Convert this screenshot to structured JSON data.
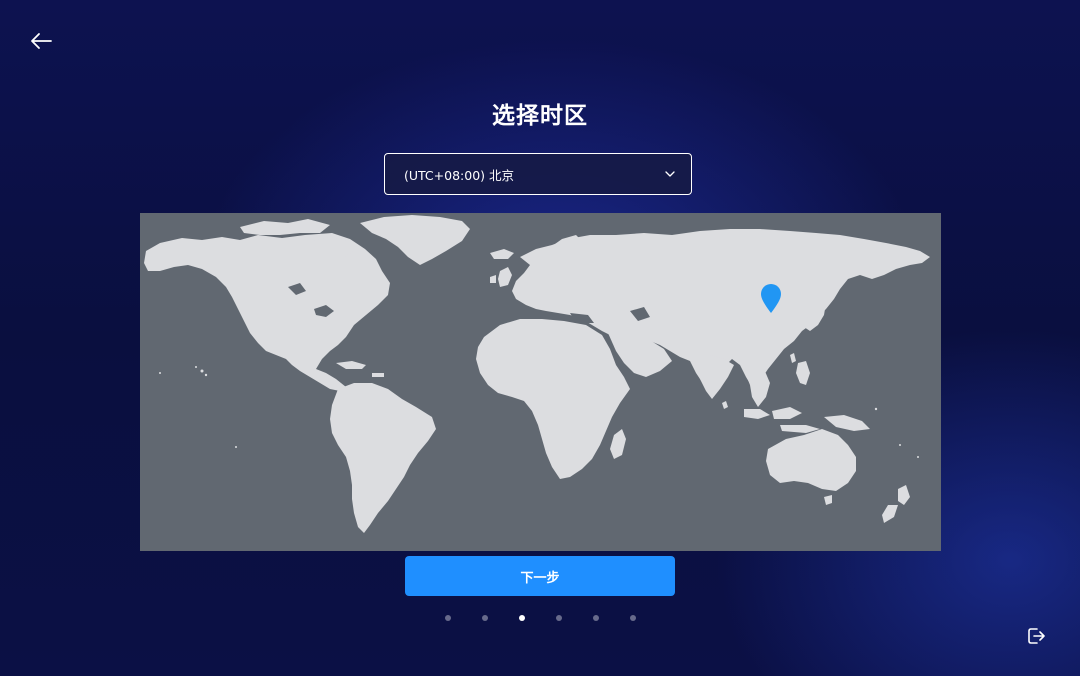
{
  "header": {
    "back_icon": "arrow-left-icon",
    "title": "选择时区"
  },
  "timezone_select": {
    "value": "(UTC+08:00) 北京",
    "chevron_icon": "chevron-down-icon"
  },
  "map": {
    "marker_icon": "map-pin-icon",
    "marker_location": "北京",
    "colors": {
      "ocean": "#616871",
      "land": "#dcdde0",
      "marker": "#2196f3"
    }
  },
  "next_button": {
    "label": "下一步"
  },
  "pager": {
    "total": 6,
    "active_index": 2
  },
  "footer": {
    "exit_icon": "logout-icon"
  },
  "colors": {
    "background": "#0b1045",
    "accent": "#1f8fff",
    "text": "#ffffff"
  }
}
